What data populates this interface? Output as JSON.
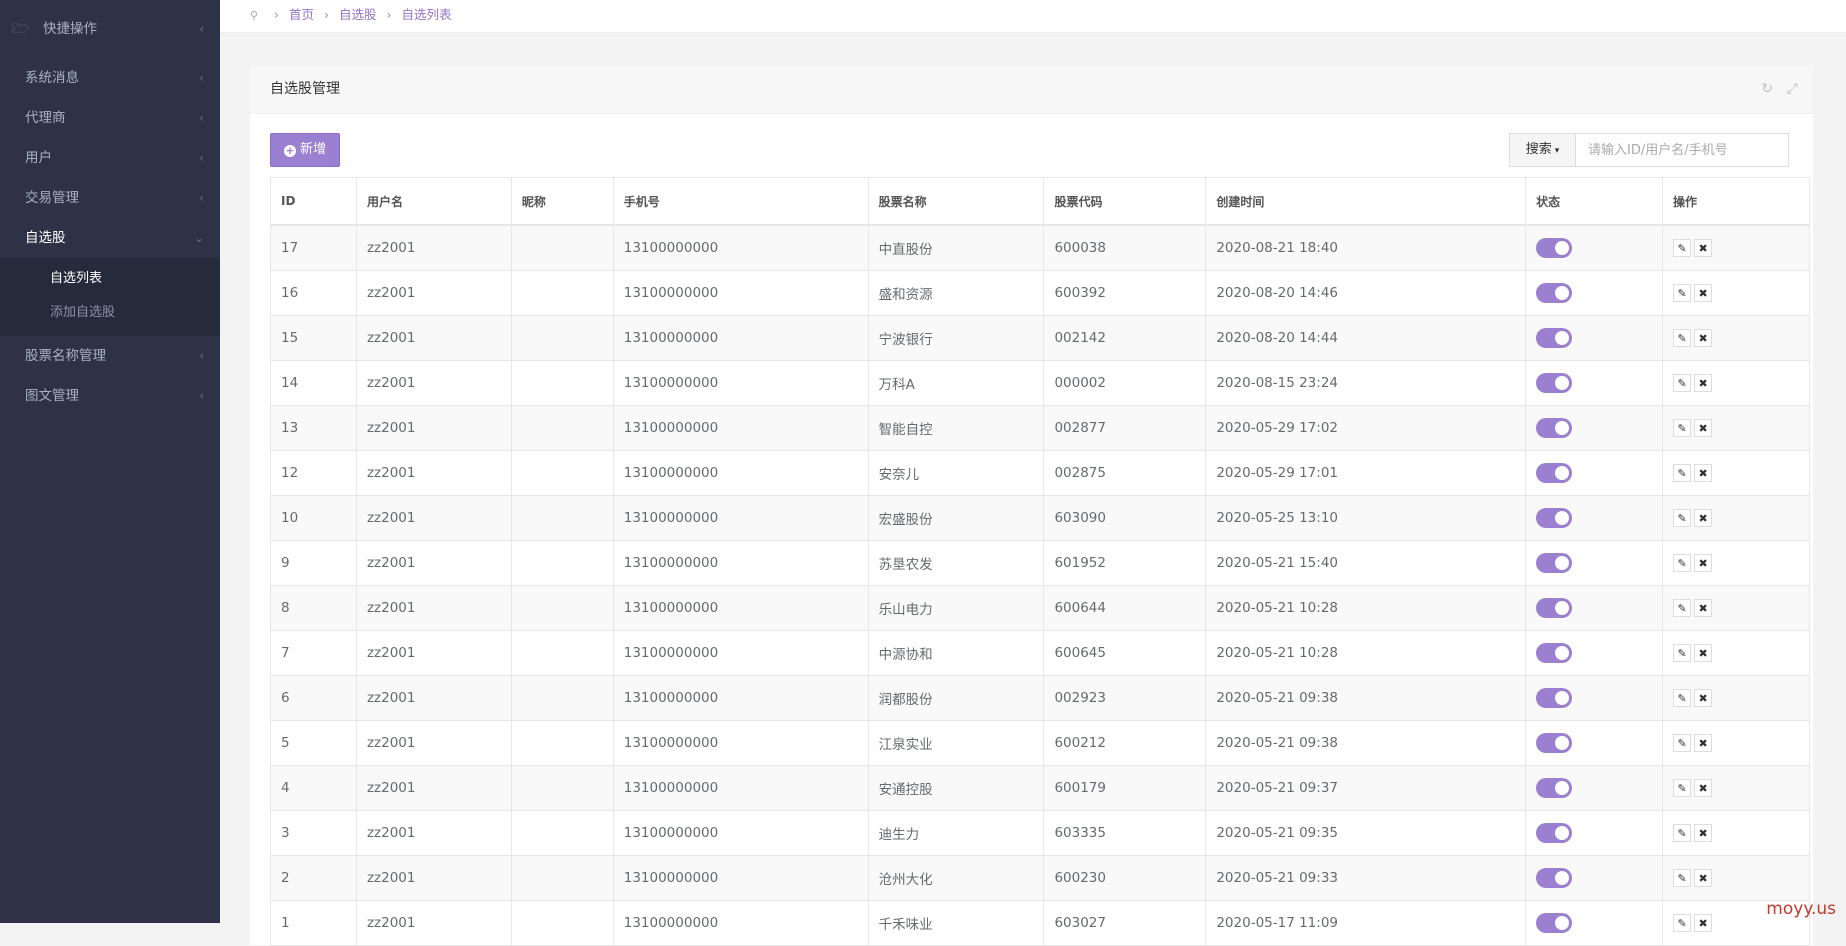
{
  "sidebar": {
    "items": [
      {
        "label": "快捷操作"
      },
      {
        "label": "系统消息"
      },
      {
        "label": "代理商"
      },
      {
        "label": "用户"
      },
      {
        "label": "交易管理"
      },
      {
        "label": "自选股"
      },
      {
        "label": "股票名称管理"
      },
      {
        "label": "图文管理"
      }
    ],
    "submenu": [
      {
        "label": "自选列表"
      },
      {
        "label": "添加自选股"
      }
    ]
  },
  "breadcrumb": {
    "home": "首页",
    "section": "自选股",
    "page": "自选列表"
  },
  "panel": {
    "title": "自选股管理"
  },
  "toolbar": {
    "add_label": "新增",
    "search_label": "搜索",
    "search_placeholder": "请输入ID/用户名/手机号"
  },
  "table": {
    "headers": [
      "ID",
      "用户名",
      "昵称",
      "手机号",
      "股票名称",
      "股票代码",
      "创建时间",
      "状态",
      "操作"
    ],
    "rows": [
      {
        "id": "17",
        "user": "zz2001",
        "nick": "",
        "phone": "13100000000",
        "name": "中直股份",
        "code": "600038",
        "time": "2020-08-21 18:40"
      },
      {
        "id": "16",
        "user": "zz2001",
        "nick": "",
        "phone": "13100000000",
        "name": "盛和资源",
        "code": "600392",
        "time": "2020-08-20 14:46"
      },
      {
        "id": "15",
        "user": "zz2001",
        "nick": "",
        "phone": "13100000000",
        "name": "宁波银行",
        "code": "002142",
        "time": "2020-08-20 14:44"
      },
      {
        "id": "14",
        "user": "zz2001",
        "nick": "",
        "phone": "13100000000",
        "name": "万科A",
        "code": "000002",
        "time": "2020-08-15 23:24"
      },
      {
        "id": "13",
        "user": "zz2001",
        "nick": "",
        "phone": "13100000000",
        "name": "智能自控",
        "code": "002877",
        "time": "2020-05-29 17:02"
      },
      {
        "id": "12",
        "user": "zz2001",
        "nick": "",
        "phone": "13100000000",
        "name": "安奈儿",
        "code": "002875",
        "time": "2020-05-29 17:01"
      },
      {
        "id": "10",
        "user": "zz2001",
        "nick": "",
        "phone": "13100000000",
        "name": "宏盛股份",
        "code": "603090",
        "time": "2020-05-25 13:10"
      },
      {
        "id": "9",
        "user": "zz2001",
        "nick": "",
        "phone": "13100000000",
        "name": "苏垦农发",
        "code": "601952",
        "time": "2020-05-21 15:40"
      },
      {
        "id": "8",
        "user": "zz2001",
        "nick": "",
        "phone": "13100000000",
        "name": "乐山电力",
        "code": "600644",
        "time": "2020-05-21 10:28"
      },
      {
        "id": "7",
        "user": "zz2001",
        "nick": "",
        "phone": "13100000000",
        "name": "中源协和",
        "code": "600645",
        "time": "2020-05-21 10:28"
      },
      {
        "id": "6",
        "user": "zz2001",
        "nick": "",
        "phone": "13100000000",
        "name": "润都股份",
        "code": "002923",
        "time": "2020-05-21 09:38"
      },
      {
        "id": "5",
        "user": "zz2001",
        "nick": "",
        "phone": "13100000000",
        "name": "江泉实业",
        "code": "600212",
        "time": "2020-05-21 09:38"
      },
      {
        "id": "4",
        "user": "zz2001",
        "nick": "",
        "phone": "13100000000",
        "name": "安通控股",
        "code": "600179",
        "time": "2020-05-21 09:37"
      },
      {
        "id": "3",
        "user": "zz2001",
        "nick": "",
        "phone": "13100000000",
        "name": "迪生力",
        "code": "603335",
        "time": "2020-05-21 09:35"
      },
      {
        "id": "2",
        "user": "zz2001",
        "nick": "",
        "phone": "13100000000",
        "name": "沧州大化",
        "code": "600230",
        "time": "2020-05-21 09:33"
      },
      {
        "id": "1",
        "user": "zz2001",
        "nick": "",
        "phone": "13100000000",
        "name": "千禾味业",
        "code": "603027",
        "time": "2020-05-17 11:09"
      }
    ]
  },
  "watermark": "moyy.us",
  "colors": {
    "accent": "#9b7fd1",
    "sidebar": "#2f3246"
  }
}
